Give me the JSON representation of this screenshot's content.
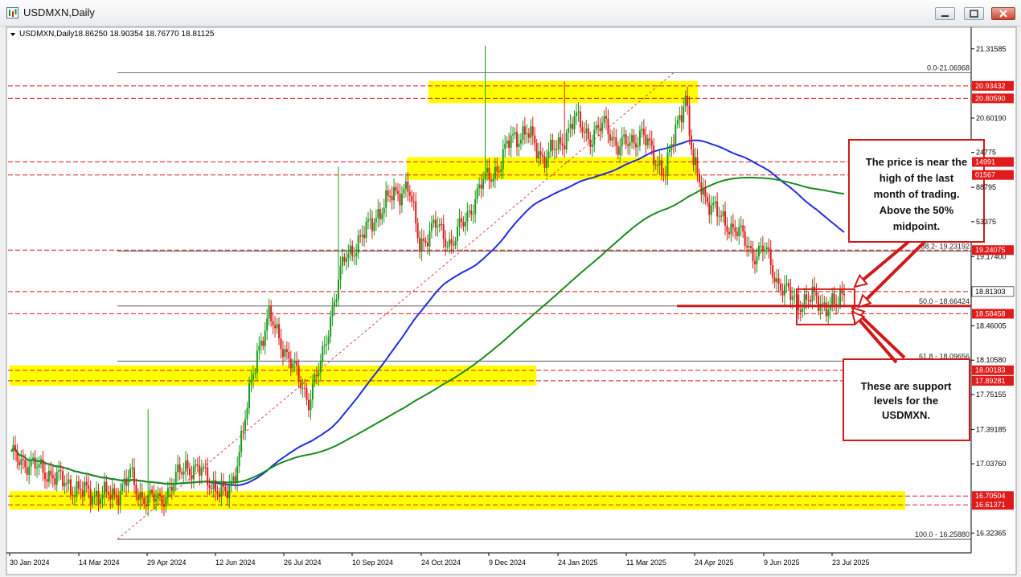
{
  "window": {
    "title": "USDMXN,Daily",
    "buttons": [
      "minimize",
      "maximize",
      "close"
    ]
  },
  "chart_header": {
    "symbol": "USDMXN,Daily",
    "ohlc": "18.86250 18.90354 18.76770 18.81125"
  },
  "chart_data": {
    "type": "candlestick",
    "symbol": "USDMXN",
    "timeframe": "Daily",
    "ylim": [
      16.16,
      21.48
    ],
    "x_tick_labels": [
      "30 Jan 2024",
      "14 Mar 2024",
      "29 Apr 2024",
      "12 Jun 2024",
      "26 Jul 2024",
      "10 Sep 2024",
      "24 Oct 2024",
      "9 Dec 2024",
      "24 Jan 2025",
      "11 Mar 2025",
      "24 Apr 2025",
      "9 Jun 2025",
      "23 Jul 2025"
    ],
    "y_tick_labels": [
      {
        "value": 21.31585,
        "label": "21.31585"
      },
      {
        "value": 20.6019,
        "label": "20.60190"
      },
      {
        "value": 20.24775,
        "label": "24775"
      },
      {
        "value": 19.88795,
        "label": "88795"
      },
      {
        "value": 19.53375,
        "label": "53375"
      },
      {
        "value": 19.174,
        "label": "19.17400"
      },
      {
        "value": 18.46005,
        "label": "18.46005"
      },
      {
        "value": 18.1058,
        "label": "18.10580"
      },
      {
        "value": 17.75155,
        "label": "17.75155"
      },
      {
        "value": 17.39185,
        "label": "17.39185"
      },
      {
        "value": 17.0376,
        "label": "17.03760"
      },
      {
        "value": 16.32365,
        "label": "16.32365"
      }
    ],
    "price_labels": [
      {
        "value": 20.93432,
        "label": "20.93432",
        "color": "#e01b1b"
      },
      {
        "value": 20.8059,
        "label": "20.80590",
        "color": "#e01b1b"
      },
      {
        "value": 20.14991,
        "label": "14991",
        "color": "#e01b1b"
      },
      {
        "value": 20.01567,
        "label": "01567",
        "color": "#e01b1b"
      },
      {
        "value": 19.24075,
        "label": "19.24075",
        "color": "#e01b1b"
      },
      {
        "value": 18.81303,
        "label": "18.81303",
        "color": "#ffffff"
      },
      {
        "value": 18.58458,
        "label": "18.58458",
        "color": "#e01b1b"
      },
      {
        "value": 18.00183,
        "label": "18.00183",
        "color": "#e01b1b"
      },
      {
        "value": 17.89281,
        "label": "17.89281",
        "color": "#e01b1b"
      },
      {
        "value": 16.70504,
        "label": "16.70504",
        "color": "#e01b1b"
      },
      {
        "value": 16.61371,
        "label": "16.61371",
        "color": "#e01b1b"
      }
    ],
    "fibonacci": [
      {
        "level": "0.0",
        "value": 21.06968,
        "label": "0.0-21.06968"
      },
      {
        "level": "38.2",
        "value": 19.23192,
        "label": "38.2- 19.23192"
      },
      {
        "level": "50.0",
        "value": 18.66424,
        "label": "50.0 - 18.66424"
      },
      {
        "level": "61.8",
        "value": 18.09656,
        "label": "61.8 - 18.09656"
      },
      {
        "level": "100.0",
        "value": 16.2588,
        "label": "100.0 - 16.25880"
      }
    ],
    "support_zones": [
      {
        "from": 20.8059,
        "to": 20.93432,
        "x_from_date": "3 Oct 2024",
        "x_to_date": "8 Apr 2025"
      },
      {
        "from": 20.01567,
        "to": 20.14991,
        "x_from_date": "30 Sep 2024",
        "x_to_date": "8 Apr 2025"
      },
      {
        "from": 17.89281,
        "to": 18.00183,
        "x_from_date": "30 Jan 2024",
        "x_to_date": "30 Nov 2024"
      },
      {
        "from": 16.61371,
        "to": 16.70504,
        "x_from_date": "30 Jan 2024",
        "x_to_date": "5 Sep 2025"
      }
    ],
    "moving_averages": [
      {
        "name": "100-day MA",
        "color": "#1f2ee0"
      },
      {
        "name": "200-day MA",
        "color": "#1b8a1b"
      }
    ],
    "grid": false,
    "annotations": [
      "The price is near the high of the last month of trading. Above the 50% midpoint.",
      "These are support levels for the USDMXN."
    ]
  },
  "annotations": {
    "box1": [
      "The price is near the",
      "high of the last",
      "month of trading.",
      "Above the 50%",
      "midpoint."
    ],
    "box2": [
      "These are support",
      "levels for the",
      "USDMXN."
    ]
  },
  "colors": {
    "bull": "#1a9a1a",
    "bear": "#e01b1b",
    "zone": "#ffff00",
    "ma100": "#1f2ee0",
    "ma200": "#1b8a1b",
    "annotation": "#d0191a"
  }
}
